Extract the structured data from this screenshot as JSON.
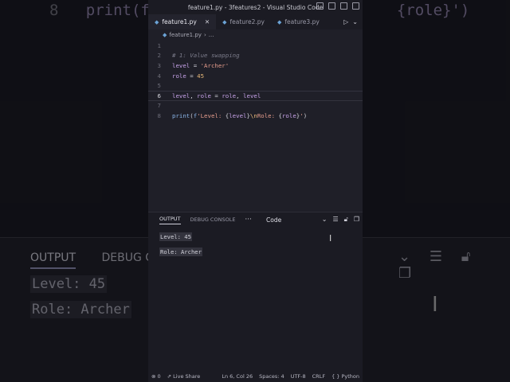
{
  "window": {
    "title": "feature1.py - 3features2 - Visual Studio Code"
  },
  "tabs": [
    {
      "label": "feature1.py",
      "active": true
    },
    {
      "label": "feature2.py",
      "active": false
    },
    {
      "label": "feature3.py",
      "active": false
    }
  ],
  "breadcrumb": {
    "file": "feature1.py",
    "rest": "..."
  },
  "editor": {
    "lines": [
      {
        "num": "1",
        "text": ""
      },
      {
        "num": "2",
        "text": "# 1: Value swapping"
      },
      {
        "num": "3",
        "text": "level = 'Archer'"
      },
      {
        "num": "4",
        "text": "role = 45"
      },
      {
        "num": "5",
        "text": ""
      },
      {
        "num": "6",
        "text": "level, role = role, level"
      },
      {
        "num": "7",
        "text": ""
      },
      {
        "num": "8",
        "text": "print(f'Level: {level}\\nRole: {role}')"
      }
    ],
    "current_line": "6"
  },
  "panel": {
    "tab_output": "OUTPUT",
    "tab_debug": "DEBUG CONSOLE",
    "more": "···",
    "channel": "Code",
    "output_lines": [
      "Level: 45",
      "Role: Archer"
    ]
  },
  "statusbar": {
    "problems": "0",
    "live_share": "Live Share",
    "position": "Ln 6, Col 26",
    "spaces": "Spaces: 4",
    "encoding": "UTF-8",
    "eol": "CRLF",
    "language": "Python"
  },
  "background": {
    "line_num": "8",
    "code_left": "print(f",
    "code_right": "{role}')",
    "tab_output": "OUTPUT",
    "tab_debug": "DEBUG C",
    "output_lines": [
      "Level: 45",
      "Role: Archer"
    ]
  }
}
